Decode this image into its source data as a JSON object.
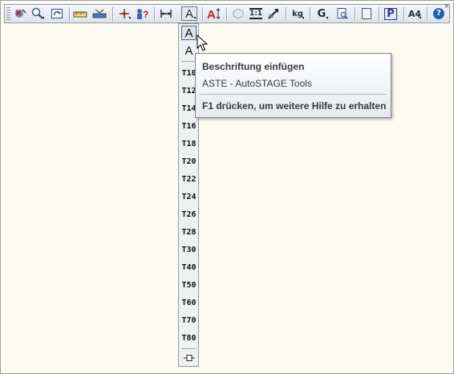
{
  "toolbar": {
    "buttons": [
      {
        "name": "rotate-view-icon"
      },
      {
        "name": "zoom-icon"
      },
      {
        "name": "redraw-icon"
      },
      {
        "name": "ruler-icon"
      },
      {
        "name": "level-icon"
      },
      {
        "name": "crosshair-icon"
      },
      {
        "name": "question-person-icon"
      },
      {
        "name": "dimension-icon"
      },
      {
        "name": "text-tool-icon",
        "label": "A"
      },
      {
        "name": "text-height-icon",
        "label": "A"
      },
      {
        "name": "cube-icon"
      },
      {
        "name": "scale-icon",
        "label": "1:1"
      },
      {
        "name": "pointer-icon"
      },
      {
        "name": "weight-icon",
        "label": "kg"
      },
      {
        "name": "g-icon",
        "label": "G"
      },
      {
        "name": "preview-icon"
      },
      {
        "name": "sheet-icon"
      },
      {
        "name": "p-icon",
        "label": "P"
      },
      {
        "name": "paper-size-icon",
        "label": "A4"
      },
      {
        "name": "help-icon",
        "label": "?"
      }
    ]
  },
  "dropdown": {
    "top_items": [
      "A",
      "A"
    ],
    "sizes": [
      "T10",
      "T12",
      "T14",
      "T16",
      "T18",
      "T20",
      "T22",
      "T24",
      "T26",
      "T28",
      "T30",
      "T40",
      "T50",
      "T60",
      "T70",
      "T80"
    ]
  },
  "tooltip": {
    "title": "Beschriftung einfügen",
    "description": "ASTE - AutoSTAGE Tools",
    "help": "F1 drücken, um weitere Hilfe zu erhalten"
  },
  "colors": {
    "background": "#fdfbf0",
    "toolbar": "#dde3ec",
    "tooltip_border": "#7a8495",
    "help_blue": "#1d5fb8",
    "red": "#c42020"
  }
}
